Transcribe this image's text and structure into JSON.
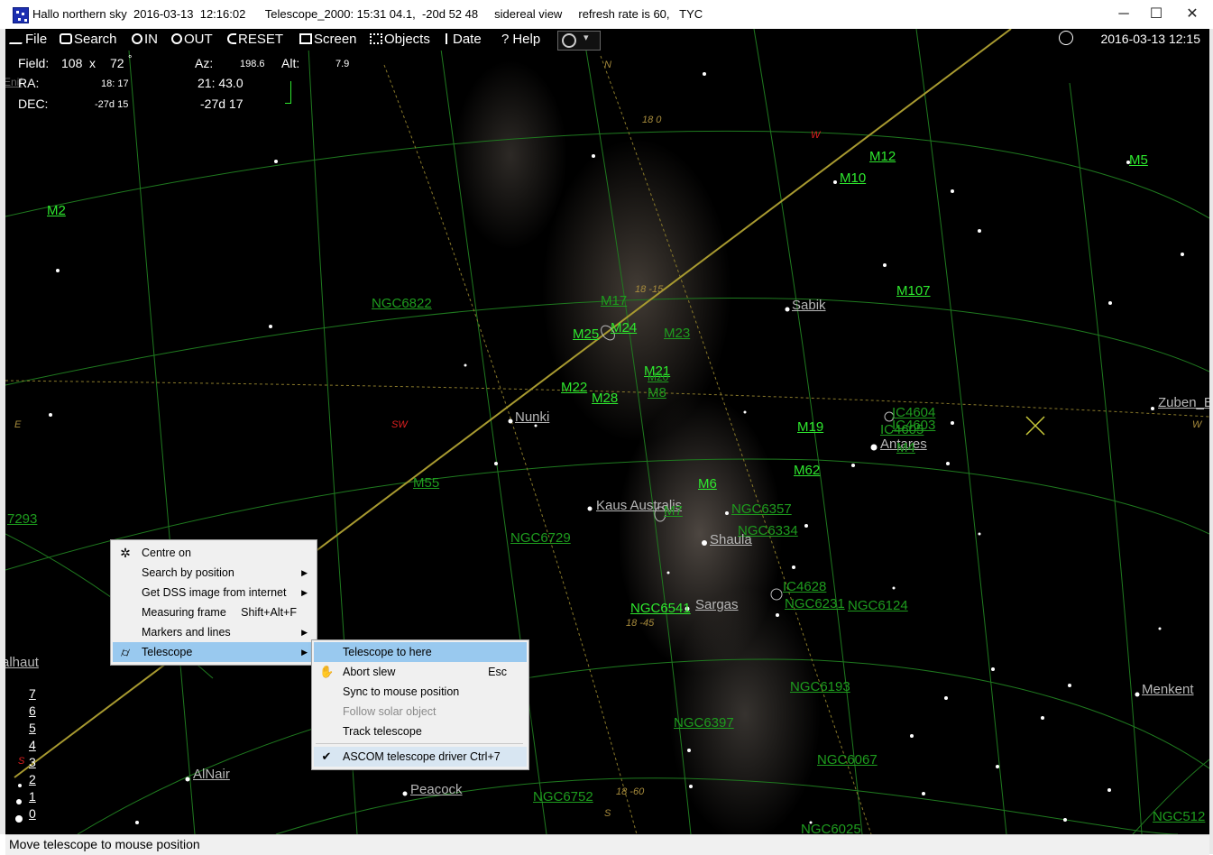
{
  "window": {
    "title": "Hallo northern sky  2016-03-13  12:16:02      Telescope_2000: 15:31 04.1,  -20d 52 48     sidereal view     refresh rate is 60,   TYC",
    "minimize": "─",
    "maximize": "☐",
    "close": "✕"
  },
  "toolbar": {
    "file": "File",
    "search": "Search",
    "zoom_in": "IN",
    "zoom_out": "OUT",
    "reset": "RESET",
    "screen": "Screen",
    "objects": "Objects",
    "date": "Date",
    "help": "Help"
  },
  "clock": {
    "datetime": "2016-03-13  12:15"
  },
  "info": {
    "field_label": "Field:",
    "field_w": "108",
    "field_x": "x",
    "field_h": "72",
    "field_unit": "°",
    "az_label": "Az:",
    "az_value": "198.6",
    "alt_label": "Alt:",
    "alt_value": "7.9",
    "ra_label": "RA:",
    "ra_small": "18: 17",
    "ra_value": "21: 43.0",
    "dec_label": "DEC:",
    "dec_small": "-27d 15",
    "dec_value": "-27d 17"
  },
  "directions": {
    "n": "N",
    "w_top": "W",
    "sw": "SW",
    "e": "E",
    "w_right": "W",
    "s": "S",
    "s_bottom": "S"
  },
  "ticks": {
    "t1": "18  0",
    "t2": "18 -15",
    "t3": "18 -45",
    "t4": "18 -60"
  },
  "objects": {
    "m12": "M12",
    "m10": "M10",
    "m5": "M5",
    "m2": "M2",
    "m107": "M107",
    "m17": "M17",
    "m24": "M24",
    "m25": "M25",
    "m23": "M23",
    "m21": "M21",
    "m20": "M20",
    "m8": "M8",
    "m22": "M22",
    "m28": "M28",
    "m19": "M19",
    "m62": "M62",
    "m6": "M6",
    "m7": "M7",
    "m55": "M55",
    "m4": "M4",
    "ngc6822": "NGC6822",
    "ngc6357": "NGC6357",
    "ngc6334": "NGC6334",
    "ngc6729": "NGC6729",
    "ngc6541": "NGC6541",
    "ngc6231": "NGC6231",
    "ngc6124": "NGC6124",
    "ngc6193": "NGC6193",
    "ngc6397": "NGC6397",
    "ngc6067": "NGC6067",
    "ngc6752": "NGC6752",
    "ngc6025": "NGC6025",
    "ngc512": "NGC512",
    "ic4604": "IC4604",
    "ic4603": "IC4603",
    "ic4605": "IC4605",
    "ic4628": "IC4628",
    "n7293": "7293",
    "sabik": "Sabik",
    "nunki": "Nunki",
    "antares": "Antares",
    "kaus": "Kaus  Australis",
    "shaula": "Shaula",
    "sargas": "Sargas",
    "menkent": "Menkent",
    "alnair": "AlNair",
    "peacock": "Peacock",
    "zuben": "Zuben_E",
    "fomalhaut": "alhaut",
    "enif": "Enif"
  },
  "magnitudes": [
    "7",
    "6",
    "5",
    "4",
    "3",
    "2",
    "1",
    "0"
  ],
  "context_menu": {
    "items": [
      {
        "label": "Centre on",
        "shortcut": "",
        "arrow": ""
      },
      {
        "label": "Search by position",
        "shortcut": "",
        "arrow": "▶"
      },
      {
        "label": "Get DSS image from internet",
        "shortcut": "",
        "arrow": "▶"
      },
      {
        "label": "Measuring frame",
        "shortcut": "Shift+Alt+F",
        "arrow": ""
      },
      {
        "label": "Markers and lines",
        "shortcut": "",
        "arrow": "▶"
      },
      {
        "label": "Telescope",
        "shortcut": "",
        "arrow": "▶"
      }
    ]
  },
  "telescope_submenu": {
    "items": [
      {
        "label": "Telescope to here",
        "shortcut": ""
      },
      {
        "label": "Abort slew",
        "shortcut": "Esc"
      },
      {
        "label": "Sync to mouse position",
        "shortcut": ""
      },
      {
        "label": "Follow solar object",
        "shortcut": ""
      },
      {
        "label": "Track telescope",
        "shortcut": ""
      },
      {
        "label": "ASCOM telescope driver Ctrl+7",
        "shortcut": ""
      }
    ]
  },
  "status": {
    "text": "Move telescope to mouse position"
  },
  "colors": {
    "sky": "#000000",
    "grid": "#1f7a1f",
    "ecliptic": "#a89a30",
    "object_label": "#2ee82e",
    "highlight": "#99c9ef"
  }
}
